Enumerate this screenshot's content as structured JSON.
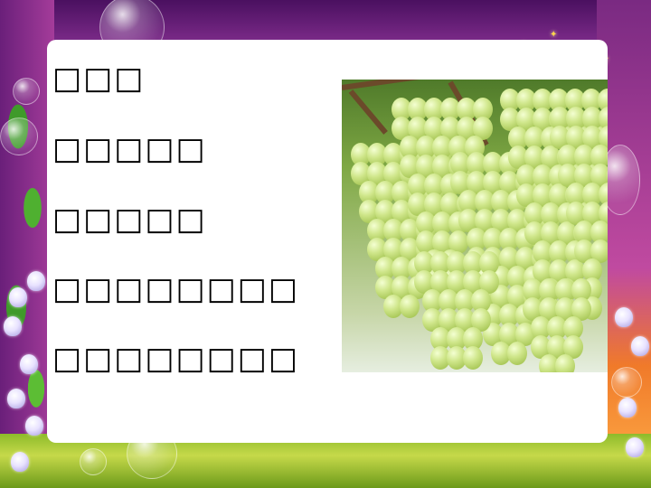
{
  "slide": {
    "lines": [
      "□□□",
      "□□□□□",
      "□□□□□",
      "□□□□□□□□",
      "□□□□□□□□"
    ]
  },
  "image": {
    "icon": "grapes-photo",
    "subject": "green grape clusters on vine"
  },
  "decorations": {
    "frame_color": "#8a2e8e",
    "accent_color": "#f07a2a",
    "grass_color": "#8dbb2a"
  }
}
